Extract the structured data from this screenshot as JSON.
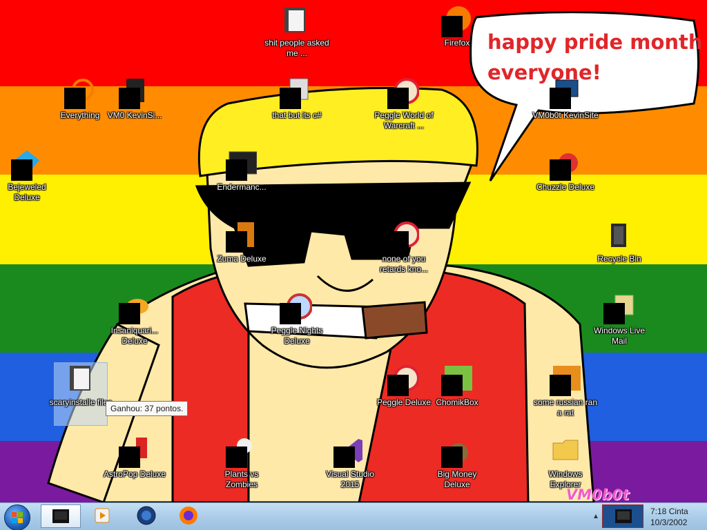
{
  "desktop": {
    "speech_text": {
      "line1": "happy pride month",
      "line2": "everyone!"
    },
    "watermark": "VM0b0t",
    "tooltip": "Ganhou: 37 pontos.",
    "rainbow": [
      "#ff0000",
      "#ff8c00",
      "#ffee00",
      "#1c8a1f",
      "#1f5fe0",
      "#7a1a9e"
    ],
    "icons": [
      {
        "id": "shit-people",
        "label": "shit people asked me ...",
        "icon": "folder-documents-icon"
      },
      {
        "id": "firefox",
        "label": "Firefox",
        "icon": "firefox-icon"
      },
      {
        "id": "everything",
        "label": "Everything",
        "icon": "search-icon"
      },
      {
        "id": "vm0-kevinsi",
        "label": "VM0 KevinSi...",
        "icon": "app-icon"
      },
      {
        "id": "that-but-c",
        "label": "that but its c#",
        "icon": "files-icon"
      },
      {
        "id": "peggle-world",
        "label": "Peggle World of Warcraft ...",
        "icon": "peggle-icon"
      },
      {
        "id": "vm0b0t-kevinsite",
        "label": "VM0b0t KevinSite",
        "icon": "monitor-icon"
      },
      {
        "id": "bejeweled",
        "label": "Bejeweled Deluxe",
        "icon": "gem-icon"
      },
      {
        "id": "endermanch",
        "label": "Endermanc...",
        "icon": "window-icon"
      },
      {
        "id": "chuzzle",
        "label": "Chuzzle Deluxe",
        "icon": "chuzzle-icon"
      },
      {
        "id": "zuma",
        "label": "Zuma Deluxe",
        "icon": "zuma-icon"
      },
      {
        "id": "none-of-you",
        "label": "none of you retards kno...",
        "icon": "peggle-icon"
      },
      {
        "id": "recycle-bin",
        "label": "Recycle Bin",
        "icon": "recycle-bin-icon"
      },
      {
        "id": "insaniquarium",
        "label": "Insaniquari... Deluxe",
        "icon": "fish-icon"
      },
      {
        "id": "peggle-nights",
        "label": "Peggle Nights Deluxe",
        "icon": "peggle-icon"
      },
      {
        "id": "windows-live-mail",
        "label": "Windows Live Mail",
        "icon": "mail-icon"
      },
      {
        "id": "scaryinstaller",
        "label": "scaryinstalle files",
        "icon": "folder-documents-icon"
      },
      {
        "id": "peggle-deluxe",
        "label": "Peggle Deluxe",
        "icon": "peggle-icon"
      },
      {
        "id": "chomikbox",
        "label": "ChomikBox",
        "icon": "hamster-icon"
      },
      {
        "id": "some-russian",
        "label": "some russian ran a rat",
        "icon": "app-icon"
      },
      {
        "id": "astropop",
        "label": "AstroPop Deluxe",
        "icon": "astropop-icon"
      },
      {
        "id": "plants-vs-zombies",
        "label": "Plants vs Zombies",
        "icon": "plant-icon"
      },
      {
        "id": "visual-studio",
        "label": "Visual Studio 2015",
        "icon": "visual-studio-icon"
      },
      {
        "id": "big-money",
        "label": "Big Money Deluxe",
        "icon": "money-bag-icon"
      },
      {
        "id": "windows-explorer",
        "label": "Windows Explorer",
        "icon": "folder-icon"
      }
    ]
  },
  "taskbar": {
    "clock": {
      "time": "7:18 Cinta",
      "date": "10/3/2002"
    },
    "items": [
      {
        "id": "vm-window",
        "icon": "monitor-icon",
        "active": true
      },
      {
        "id": "media-player",
        "icon": "media-player-icon",
        "active": false
      },
      {
        "id": "globe",
        "icon": "globe-icon",
        "active": false
      },
      {
        "id": "firefox",
        "icon": "firefox-icon",
        "active": false
      }
    ],
    "tray_expand": "▲"
  }
}
